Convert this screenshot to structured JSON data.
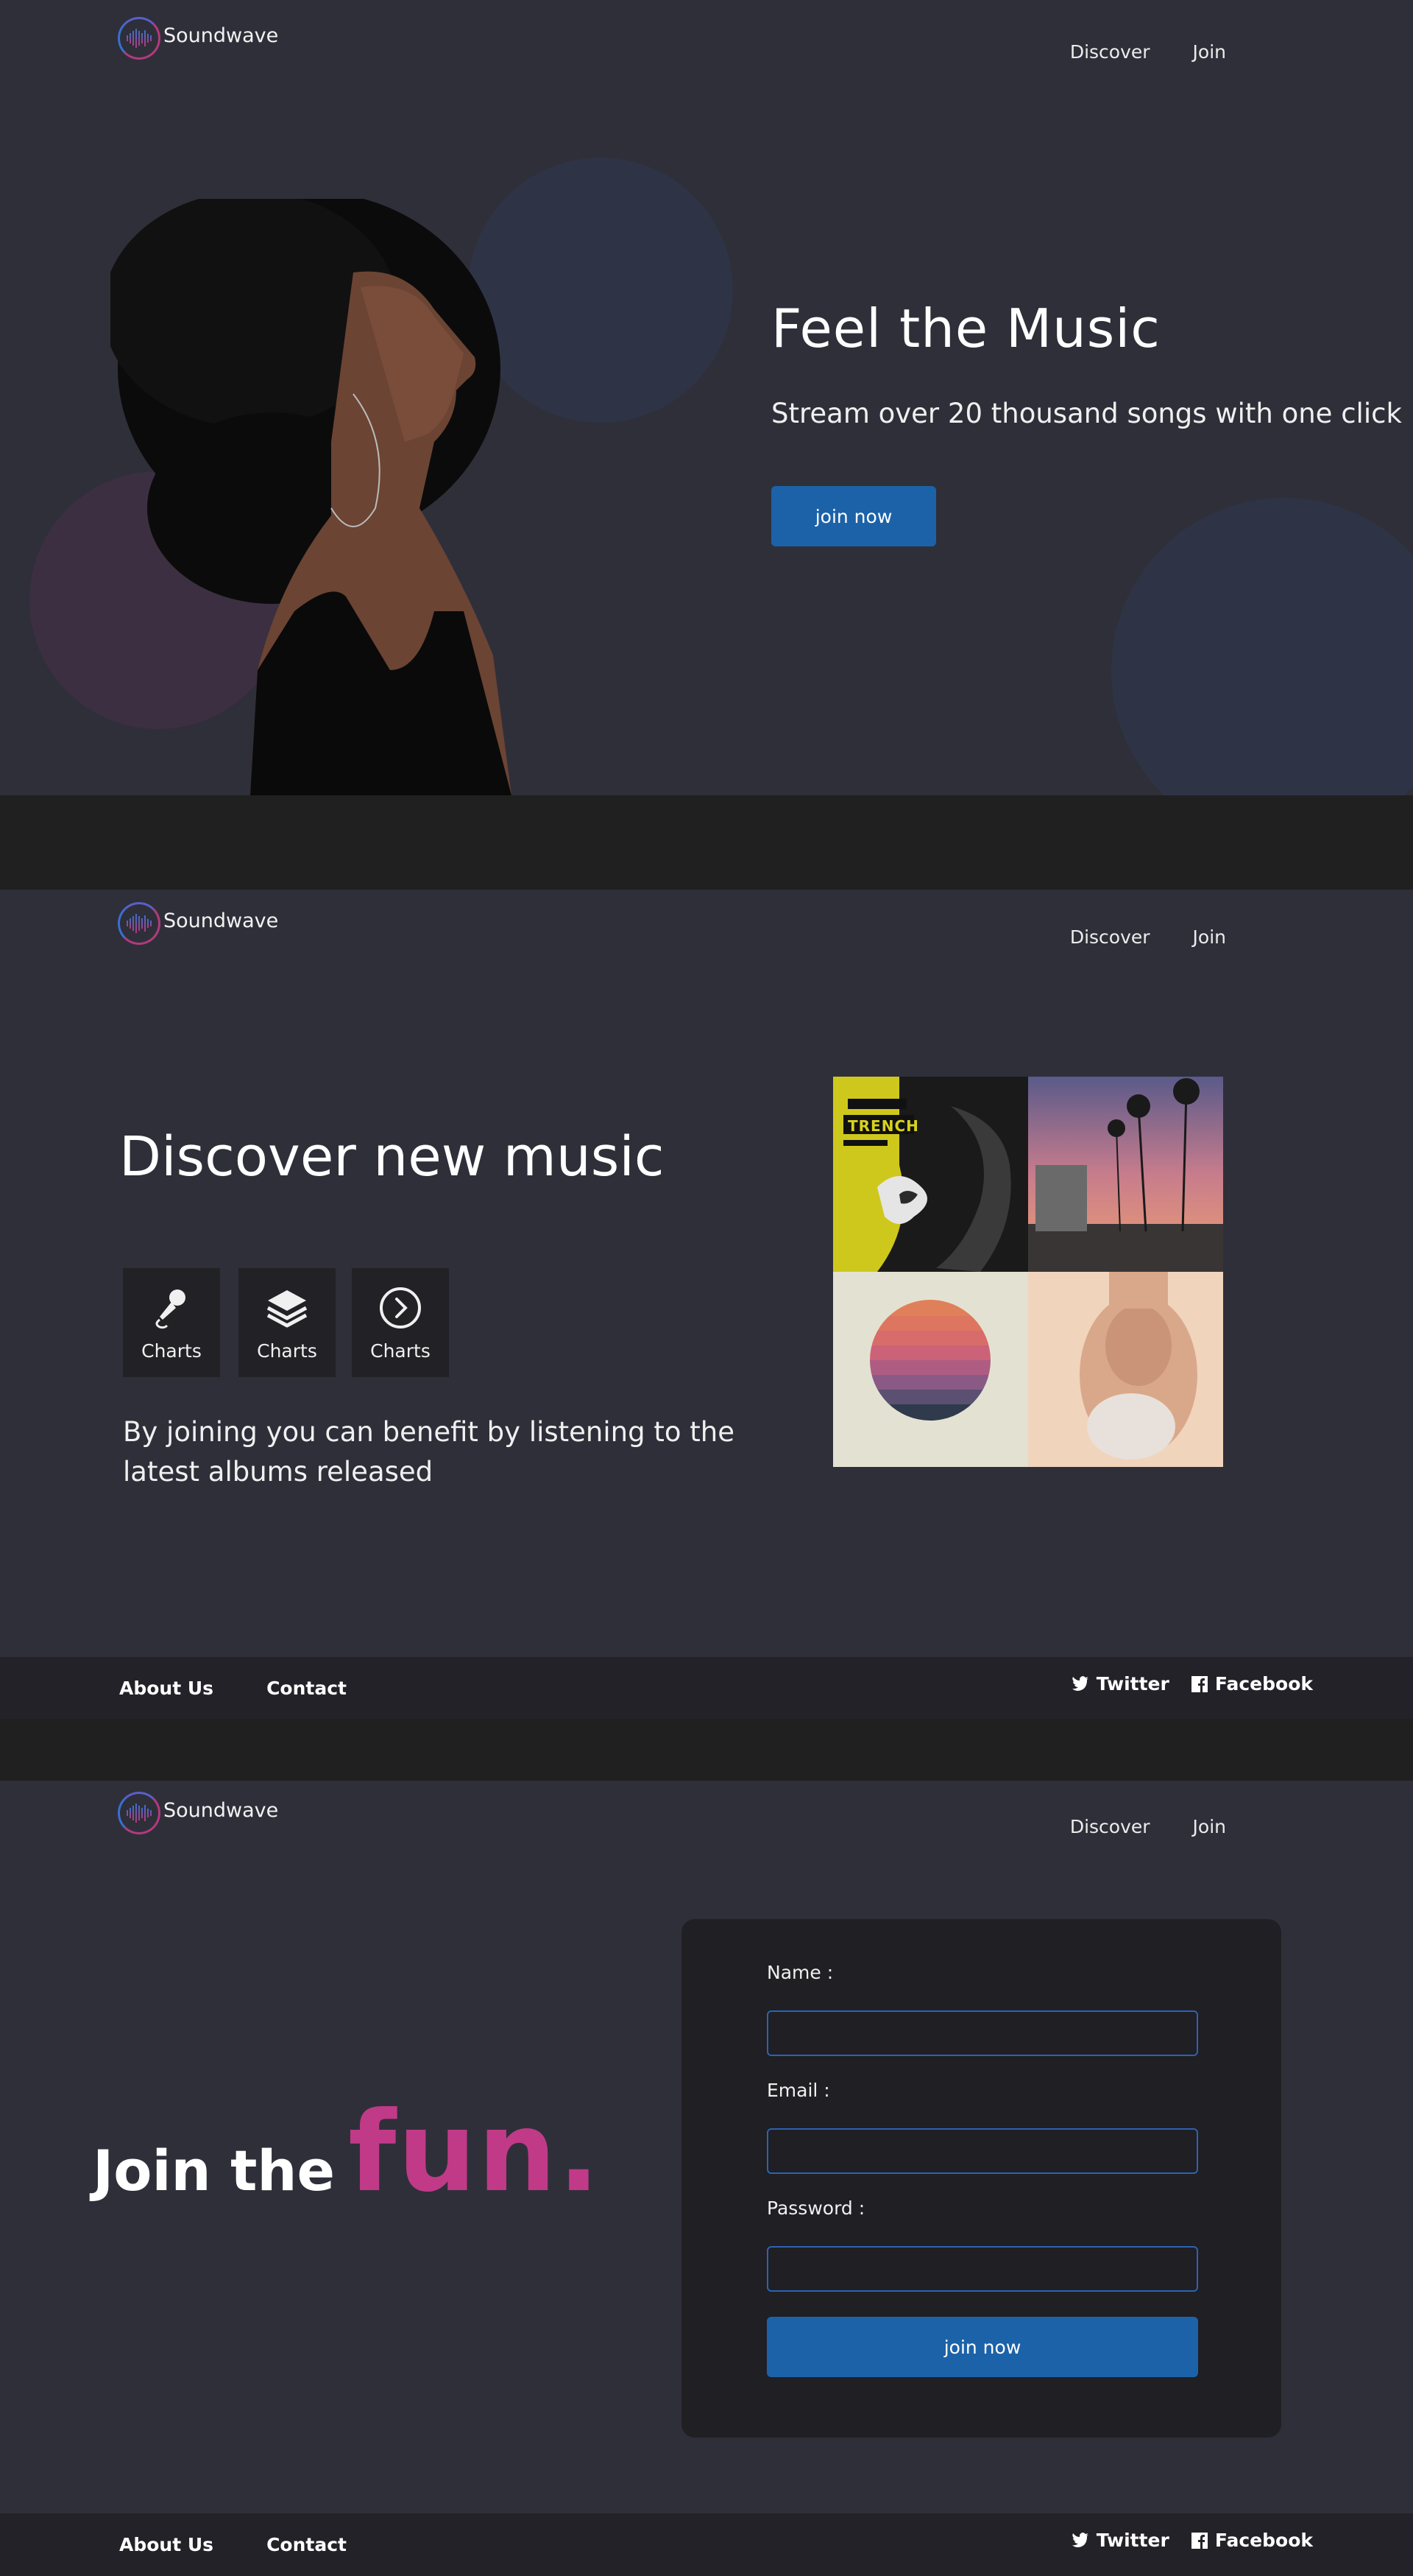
{
  "brand": {
    "name": "Soundwave"
  },
  "nav": {
    "discover": "Discover",
    "join": "Join"
  },
  "hero": {
    "title": "Feel the Music",
    "subtitle": "Stream over 20 thousand songs with one click",
    "cta": "join now"
  },
  "discover": {
    "title": "Discover new music",
    "features": [
      {
        "icon": "microphone-icon",
        "label": "Charts"
      },
      {
        "icon": "layers-icon",
        "label": "Charts"
      },
      {
        "icon": "chevron-right-circle-icon",
        "label": "Charts"
      }
    ],
    "description": "By joining you can benefit  by listening to the latest albums released",
    "album_cover_text": "TRENCH"
  },
  "footer": {
    "about": "About Us",
    "contact": "Contact",
    "twitter": "Twitter",
    "facebook": "Facebook"
  },
  "join": {
    "title_part1": "Join the",
    "title_part2": "fun.",
    "name_label": "Name :",
    "email_label": "Email :",
    "password_label": "Password :",
    "submit": "join now"
  },
  "colors": {
    "background": "#2f2f3a",
    "divider": "#202020",
    "accent_blue": "#1c62a8",
    "accent_pink": "#c03a88",
    "footer": "#222228",
    "card": "#1f1f24"
  }
}
